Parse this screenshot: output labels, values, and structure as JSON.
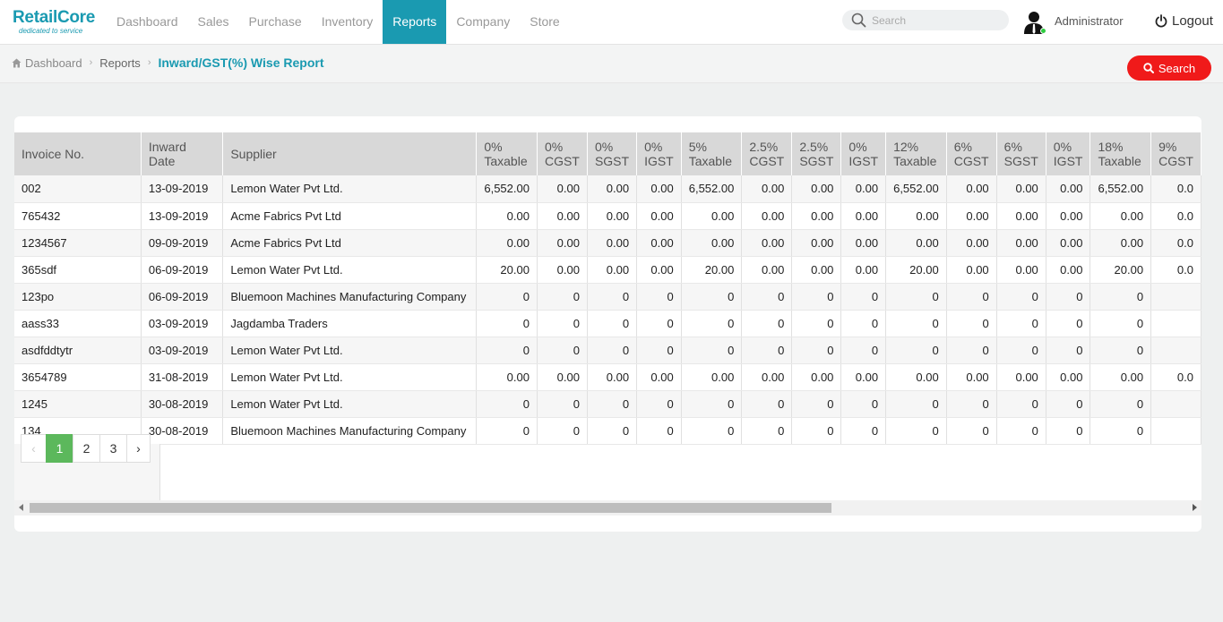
{
  "brand": {
    "name": "RetailCore",
    "tagline": "dedicated to service"
  },
  "nav": {
    "items": [
      {
        "label": "Dashboard",
        "active": false
      },
      {
        "label": "Sales",
        "active": false
      },
      {
        "label": "Purchase",
        "active": false
      },
      {
        "label": "Inventory",
        "active": false
      },
      {
        "label": "Reports",
        "active": true
      },
      {
        "label": "Company",
        "active": false
      },
      {
        "label": "Store",
        "active": false
      }
    ],
    "search_placeholder": "Search",
    "user": "Administrator",
    "logout": "Logout"
  },
  "breadcrumb": {
    "home": "Dashboard",
    "section": "Reports",
    "current": "Inward/GST(%) Wise Report"
  },
  "search_button": "Search",
  "colors": {
    "accent": "#1a9ab1",
    "danger": "#f01a1a",
    "pager_active": "#5cb85c"
  },
  "table": {
    "headers": [
      "Invoice No.",
      "Inward Date",
      "Supplier",
      "0% Taxable",
      "0% CGST",
      "0% SGST",
      "0% IGST",
      "5% Taxable",
      "2.5% CGST",
      "2.5% SGST",
      "0% IGST",
      "12% Taxable",
      "6% CGST",
      "6% SGST",
      "0% IGST",
      "18% Taxable",
      "9% CGST"
    ],
    "rows": [
      [
        "002",
        "13-09-2019",
        "Lemon Water Pvt Ltd.",
        "6,552.00",
        "0.00",
        "0.00",
        "0.00",
        "6,552.00",
        "0.00",
        "0.00",
        "0.00",
        "6,552.00",
        "0.00",
        "0.00",
        "0.00",
        "6,552.00",
        "0.0"
      ],
      [
        "765432",
        "13-09-2019",
        "Acme Fabrics Pvt Ltd",
        "0.00",
        "0.00",
        "0.00",
        "0.00",
        "0.00",
        "0.00",
        "0.00",
        "0.00",
        "0.00",
        "0.00",
        "0.00",
        "0.00",
        "0.00",
        "0.0"
      ],
      [
        "1234567",
        "09-09-2019",
        "Acme Fabrics Pvt Ltd",
        "0.00",
        "0.00",
        "0.00",
        "0.00",
        "0.00",
        "0.00",
        "0.00",
        "0.00",
        "0.00",
        "0.00",
        "0.00",
        "0.00",
        "0.00",
        "0.0"
      ],
      [
        "365sdf",
        "06-09-2019",
        "Lemon Water Pvt Ltd.",
        "20.00",
        "0.00",
        "0.00",
        "0.00",
        "20.00",
        "0.00",
        "0.00",
        "0.00",
        "20.00",
        "0.00",
        "0.00",
        "0.00",
        "20.00",
        "0.0"
      ],
      [
        "123po",
        "06-09-2019",
        "Bluemoon Machines Manufacturing Company",
        "0",
        "0",
        "0",
        "0",
        "0",
        "0",
        "0",
        "0",
        "0",
        "0",
        "0",
        "0",
        "0",
        ""
      ],
      [
        "aass33",
        "03-09-2019",
        "Jagdamba Traders",
        "0",
        "0",
        "0",
        "0",
        "0",
        "0",
        "0",
        "0",
        "0",
        "0",
        "0",
        "0",
        "0",
        ""
      ],
      [
        "asdfddtytr",
        "03-09-2019",
        "Lemon Water Pvt Ltd.",
        "0",
        "0",
        "0",
        "0",
        "0",
        "0",
        "0",
        "0",
        "0",
        "0",
        "0",
        "0",
        "0",
        ""
      ],
      [
        "3654789",
        "31-08-2019",
        "Lemon Water Pvt Ltd.",
        "0.00",
        "0.00",
        "0.00",
        "0.00",
        "0.00",
        "0.00",
        "0.00",
        "0.00",
        "0.00",
        "0.00",
        "0.00",
        "0.00",
        "0.00",
        "0.0"
      ],
      [
        "1245",
        "30-08-2019",
        "Lemon Water Pvt Ltd.",
        "0",
        "0",
        "0",
        "0",
        "0",
        "0",
        "0",
        "0",
        "0",
        "0",
        "0",
        "0",
        "0",
        ""
      ],
      [
        "134",
        "30-08-2019",
        "Bluemoon Machines Manufacturing Company",
        "0",
        "0",
        "0",
        "0",
        "0",
        "0",
        "0",
        "0",
        "0",
        "0",
        "0",
        "0",
        "0",
        ""
      ]
    ]
  },
  "pagination": {
    "prev": "‹",
    "pages": [
      "1",
      "2",
      "3"
    ],
    "active": "1",
    "next": "›"
  }
}
